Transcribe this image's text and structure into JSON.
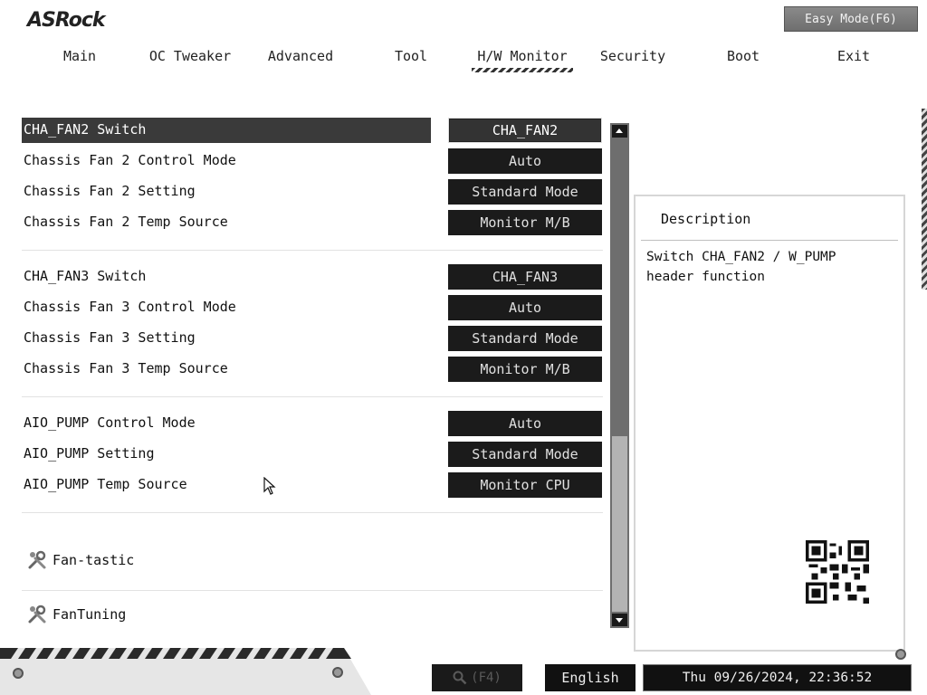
{
  "header": {
    "logo": "ASRock",
    "easy_mode": "Easy Mode(F6)"
  },
  "tabs": [
    {
      "label": "Main"
    },
    {
      "label": "OC Tweaker"
    },
    {
      "label": "Advanced"
    },
    {
      "label": "Tool"
    },
    {
      "label": "H/W Monitor"
    },
    {
      "label": "Security"
    },
    {
      "label": "Boot"
    },
    {
      "label": "Exit"
    }
  ],
  "settings": [
    {
      "label": "CHA_FAN2 Switch",
      "value": "CHA_FAN2"
    },
    {
      "label": "Chassis Fan 2 Control Mode",
      "value": "Auto"
    },
    {
      "label": "Chassis Fan 2 Setting",
      "value": "Standard Mode"
    },
    {
      "label": "Chassis Fan 2 Temp Source",
      "value": "Monitor M/B"
    },
    {
      "label": "CHA_FAN3 Switch",
      "value": "CHA_FAN3"
    },
    {
      "label": "Chassis Fan 3 Control Mode",
      "value": "Auto"
    },
    {
      "label": "Chassis Fan 3 Setting",
      "value": "Standard Mode"
    },
    {
      "label": "Chassis Fan 3 Temp Source",
      "value": "Monitor M/B"
    },
    {
      "label": "AIO_PUMP Control Mode",
      "value": "Auto"
    },
    {
      "label": "AIO_PUMP Setting",
      "value": "Standard Mode"
    },
    {
      "label": "AIO_PUMP Temp Source",
      "value": "Monitor CPU"
    }
  ],
  "tools": [
    {
      "label": "Fan-tastic"
    },
    {
      "label": "FanTuning"
    }
  ],
  "description": {
    "title": "Description",
    "text": "Switch CHA_FAN2 / W_PUMP header function"
  },
  "footer": {
    "search": "(F4)",
    "language": "English",
    "datetime": "Thu 09/26/2024, 22:36:52"
  },
  "colors": {
    "selected_row": "#3a3a3a",
    "value_box": "#1b1b1b",
    "scrollbar": "#6e6e6e"
  }
}
